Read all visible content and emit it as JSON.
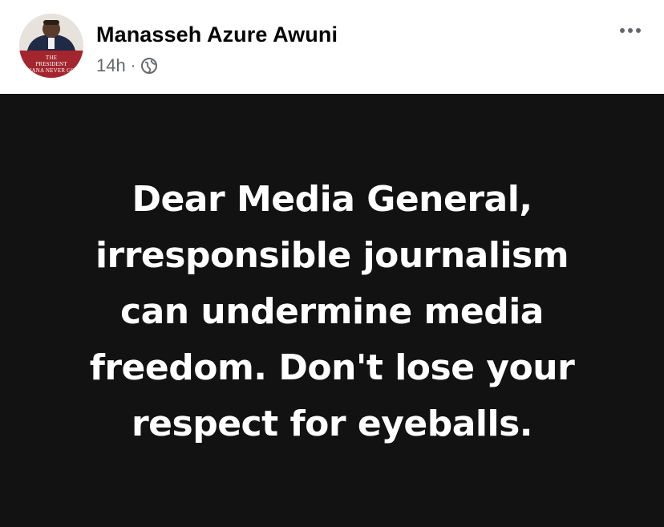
{
  "post": {
    "author": "Manasseh Azure Awuni",
    "time": "14h",
    "separator": "·",
    "privacy_icon": "globe-icon",
    "more_icon": "ellipsis-icon",
    "avatar": {
      "caption_line1": "THE",
      "caption_line2": "PRESIDENT",
      "caption_line3": "HANA NEVER GO"
    },
    "text_lines": [
      "Dear Media General,",
      "irresponsible journalism",
      "can undermine media",
      "freedom. Don't lose your",
      "respect for eyeballs."
    ]
  },
  "colors": {
    "post_background": "#121212",
    "post_text": "#ffffff",
    "author_text": "#050505",
    "meta_text": "#65676b"
  }
}
